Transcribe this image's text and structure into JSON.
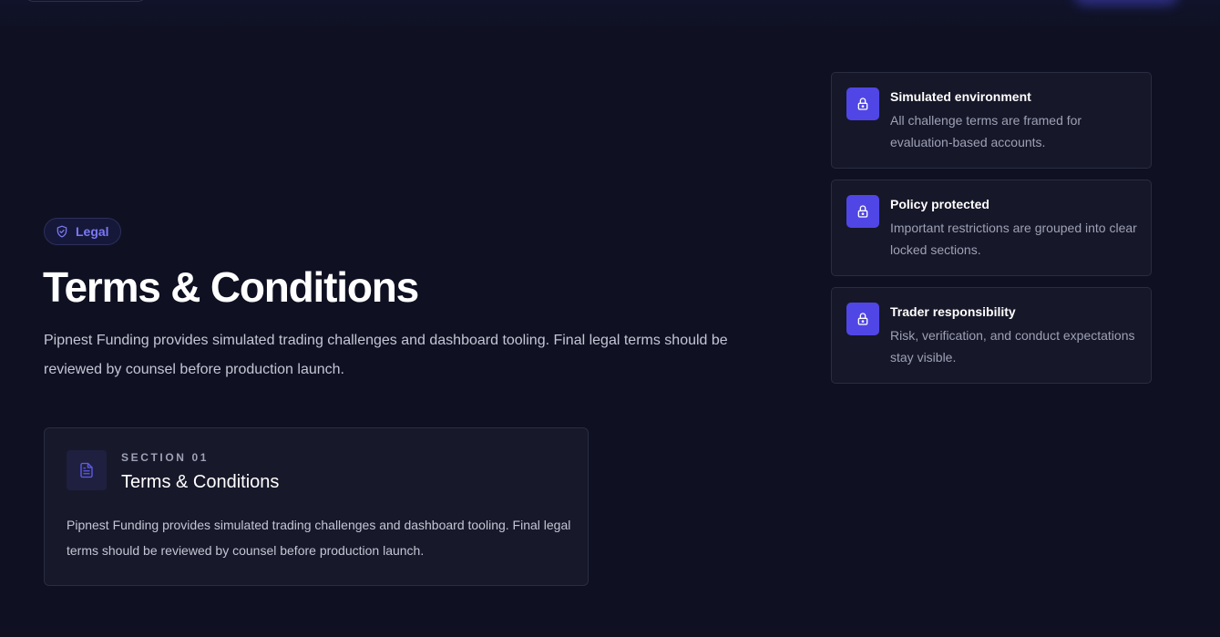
{
  "badge": {
    "label": "Legal",
    "icon": "shield-check-icon"
  },
  "hero": {
    "title": "Terms & Conditions",
    "intro": "Pipnest Funding provides simulated trading challenges and dashboard tooling. Final legal terms should be reviewed by counsel before production launch."
  },
  "section": {
    "eyebrow": "SECTION 01",
    "title": "Terms & Conditions",
    "icon": "document-icon",
    "body": "Pipnest Funding provides simulated trading challenges and dashboard tooling. Final legal terms should be reviewed by counsel before production launch."
  },
  "features": [
    {
      "icon": "lock-icon",
      "title": "Simulated environment",
      "description": "All challenge terms are framed for evaluation-based accounts."
    },
    {
      "icon": "lock-icon",
      "title": "Policy protected",
      "description": "Important restrictions are grouped into clear locked sections."
    },
    {
      "icon": "lock-icon",
      "title": "Trader responsibility",
      "description": "Risk, verification, and conduct expectations stay visible."
    }
  ],
  "colors": {
    "background": "#0f1122",
    "accent": "#5046e5",
    "accent_text": "#7a78f5",
    "card": "#171829",
    "border": "#2a2c40"
  }
}
